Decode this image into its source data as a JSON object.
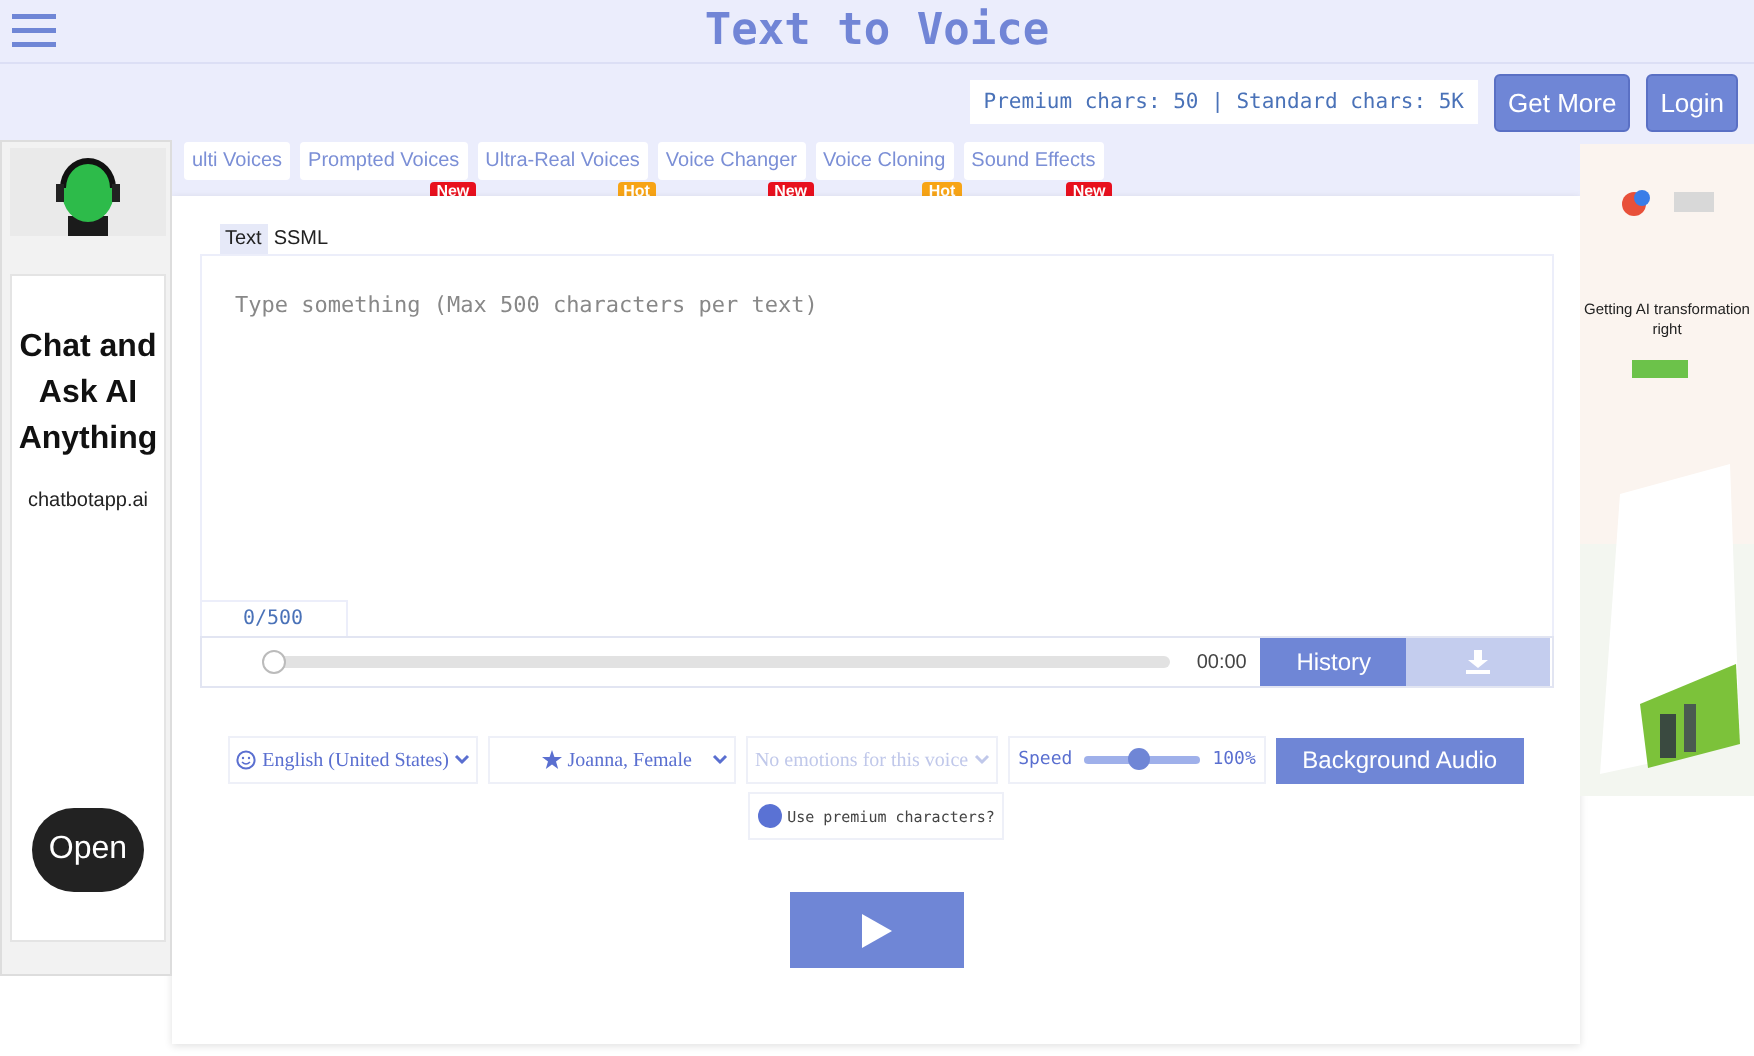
{
  "header": {
    "title": "Text to Voice"
  },
  "account": {
    "usage": "Premium chars: 50 | Standard chars: 5K",
    "buttons": [
      "Get More",
      "Login"
    ]
  },
  "tabs": [
    {
      "label": "ulti Voices"
    },
    {
      "label": "Prompted Voices",
      "badge": "New",
      "color": "#e8101e"
    },
    {
      "label": "Ultra-Real Voices",
      "badge": "Hot",
      "color": "#f7a416"
    },
    {
      "label": "Voice Changer",
      "badge": "New",
      "color": "#e8101e"
    },
    {
      "label": "Voice Cloning",
      "badge": "Hot",
      "color": "#f7a416"
    },
    {
      "label": "Sound Effects",
      "badge": "New",
      "color": "#e8101e"
    }
  ],
  "editor": {
    "modes": [
      {
        "label": "Text",
        "selected": true
      },
      {
        "label": "SSML",
        "selected": false
      }
    ],
    "placeholder": "Type something (Max 500 characters per text)",
    "counter": "0/500"
  },
  "player": {
    "level": 0,
    "time": "00:00",
    "history": "History"
  },
  "options": {
    "language": "English (United States)",
    "voice": "Joanna, Female",
    "emotion": {
      "placeholder": "No emotions for this voice",
      "disabled": true
    },
    "speed": {
      "label": "Speed",
      "level": 0.47,
      "reading": "100%"
    },
    "background": "Background Audio",
    "premium": {
      "label": "Use premium characters?"
    }
  },
  "left_ad": {
    "headline": "Chat and Ask AI Anything",
    "site": "chatbotapp.ai",
    "button": "Open"
  },
  "right_ad": {
    "headline": "Getting AI transformation right"
  }
}
